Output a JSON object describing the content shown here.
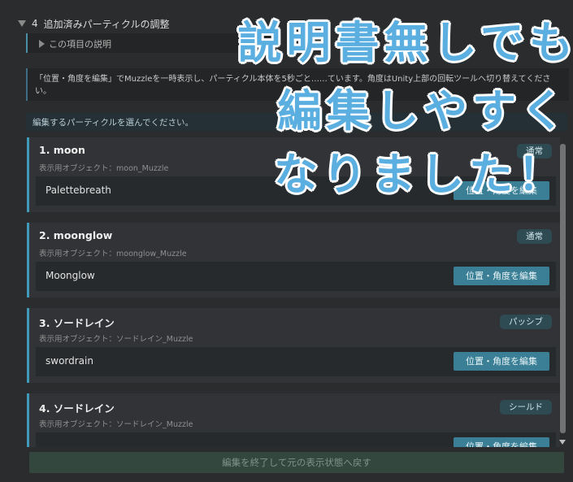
{
  "header": {
    "index": "4",
    "title": "追加済みパーティクルの調整"
  },
  "description_toggle": {
    "label": "この項目の説明"
  },
  "info_text": "「位置・角度を編集」でMuzzleを一時表示し、パーティクル本体を5秒ごと……ています。角度はUnity上部の回転ツールへ切り替えてください。",
  "select_prompt": "編集するパーティクルを選んでください。",
  "cards": [
    {
      "title": "1.  moon",
      "object_label": "表示用オブジェクト：moon_Muzzle",
      "badge": "通常",
      "particle_name": "Palettebreath",
      "edit_button": "位置・角度を編集"
    },
    {
      "title": "2.  moonglow",
      "object_label": "表示用オブジェクト：moonglow_Muzzle",
      "badge": "通常",
      "particle_name": "Moonglow",
      "edit_button": "位置・角度を編集"
    },
    {
      "title": "3.  ソードレイン",
      "object_label": "表示用オブジェクト：ソードレイン_Muzzle",
      "badge": "パッシブ",
      "particle_name": "swordrain",
      "edit_button": "位置・角度を編集"
    },
    {
      "title": "4.  ソードレイン",
      "object_label": "表示用オブジェクト：ソードレイン_Muzzle",
      "badge": "シールド",
      "particle_name": "",
      "edit_button": "位置・角度を編集"
    }
  ],
  "footer_button": "編集を終了して元の表示状態へ戻す",
  "overlay_text": [
    "説明書無しでも",
    "編集しやすく",
    "なりました！"
  ],
  "colors": {
    "accent": "#3e9ab8",
    "button": "#3a7f95",
    "overlay": "#5aaee0"
  }
}
